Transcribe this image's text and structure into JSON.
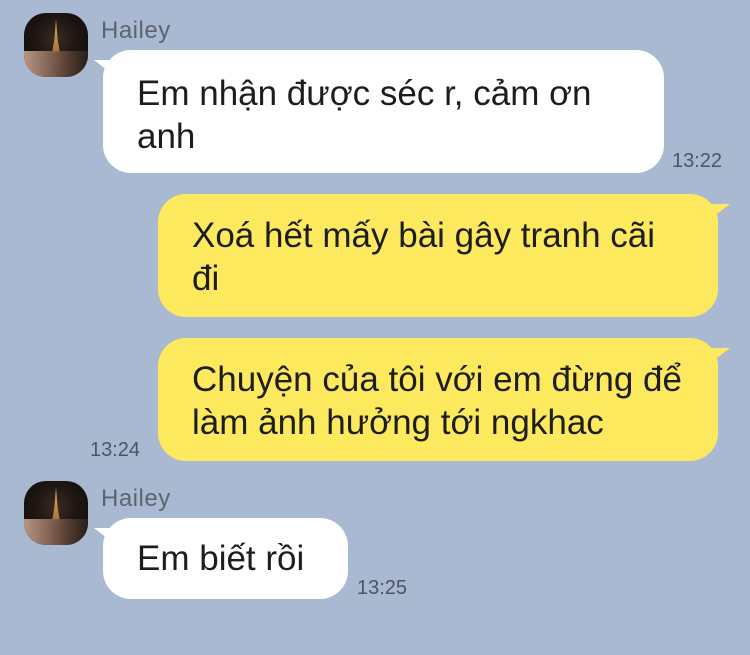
{
  "messages": [
    {
      "sender": "Hailey",
      "text": "Em nhận được séc r, cảm ơn anh",
      "time": "13:22"
    },
    {
      "text": "Xoá hết mấy bài gây tranh cãi đi"
    },
    {
      "text": "Chuyện của tôi với em đừng để làm ảnh hưởng tới ngkhac",
      "time": "13:24"
    },
    {
      "sender": "Hailey",
      "text": "Em biết rồi",
      "time": "13:25"
    }
  ],
  "colors": {
    "background": "#a9b9d1",
    "incoming_bubble": "#ffffff",
    "outgoing_bubble": "#fde95e"
  },
  "icons": {
    "avatar": "eiffel-tower-night-photo"
  }
}
